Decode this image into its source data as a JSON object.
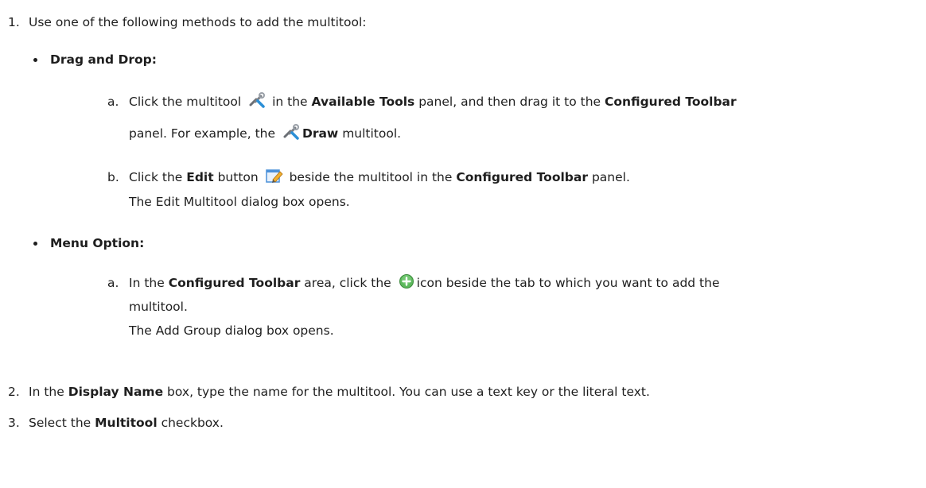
{
  "step1": {
    "num": "1.",
    "text": "Use one of the following methods to add the multitool:",
    "drag": {
      "heading": "Drag and Drop:",
      "a": {
        "label": "a.",
        "t1": "Click the multitool",
        "t2": "in the",
        "b1": "Available Tools",
        "t3": "panel, and then drag it to the",
        "b2": "Configured Toolbar",
        "t4": "panel. For example, the",
        "b3": "Draw",
        "t5": "multitool."
      },
      "b": {
        "label": "b.",
        "t1": "Click the",
        "b1": "Edit",
        "t2": "button",
        "t3": "beside the multitool in the",
        "b2": "Configured Toolbar",
        "t4": "panel.",
        "note": "The Edit Multitool dialog box opens."
      }
    },
    "menu": {
      "heading": "Menu Option:",
      "a": {
        "label": "a.",
        "t1": "In the",
        "b1": "Configured Toolbar",
        "t2": "area, click the",
        "t3": "icon beside the tab to which you want to add the",
        "t4": "multitool.",
        "note": "The Add Group dialog box opens."
      }
    }
  },
  "step2": {
    "num": "2.",
    "t1": "In the",
    "b1": "Display Name",
    "t2": "box, type the name for the multitool. You can use a text key or the literal text."
  },
  "step3": {
    "num": "3.",
    "t1": "Select the",
    "b1": "Multitool",
    "t2": "checkbox."
  },
  "icons": [
    "multitool-icon",
    "edit-icon",
    "add-icon"
  ]
}
